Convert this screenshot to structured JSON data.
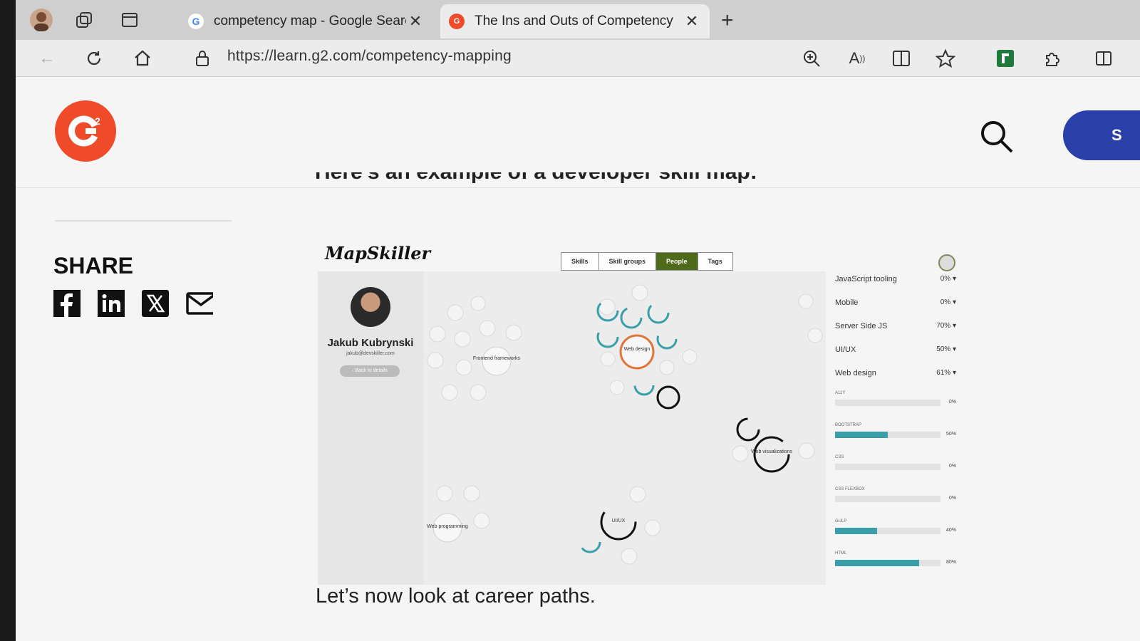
{
  "browser": {
    "tabs": [
      {
        "title": "competency map - Google Searc",
        "favicon": "G",
        "active": false
      },
      {
        "title": "The Ins and Outs of Competency",
        "favicon": "G2",
        "active": true
      }
    ],
    "url": "https://learn.g2.com/competency-mapping"
  },
  "site": {
    "logo_text": "G",
    "signup_label": "S"
  },
  "article": {
    "heading_partial": "Here's an example of a developer skill map:",
    "share_title": "SHARE",
    "share_icons": [
      "facebook-icon",
      "linkedin-icon",
      "x-icon",
      "email-icon"
    ],
    "caption": "Let’s now look at career paths."
  },
  "mapskiller": {
    "logo": "MapSkiller",
    "tabs": [
      "Skills",
      "Skill groups",
      "People",
      "Tags"
    ],
    "active_tab": "People",
    "profile": {
      "name": "Jakub Kubrynski",
      "email": "jakub@devskiller.com",
      "back_label": "‹ Back to details"
    },
    "skill_rows": [
      {
        "label": "JavaScript tooling",
        "pct": "0% ▾"
      },
      {
        "label": "Mobile",
        "pct": "0% ▾"
      },
      {
        "label": "Server Side JS",
        "pct": "70% ▾"
      },
      {
        "label": "UI/UX",
        "pct": "50% ▾"
      },
      {
        "label": "Web design",
        "pct": "61% ▾"
      }
    ],
    "bars": [
      {
        "label": "A11Y",
        "value": 0,
        "pct": "0%"
      },
      {
        "label": "BOOTSTRAP",
        "value": 50,
        "pct": "50%"
      },
      {
        "label": "CSS",
        "value": 0,
        "pct": "0%"
      },
      {
        "label": "CSS FLEXBOX",
        "value": 0,
        "pct": "0%"
      },
      {
        "label": "GULP",
        "value": 40,
        "pct": "40%"
      },
      {
        "label": "HTML",
        "value": 80,
        "pct": "80%"
      }
    ],
    "bubbles": [
      {
        "label": "Frontend frameworks"
      },
      {
        "label": "Web design"
      },
      {
        "label": "Web visualizations"
      },
      {
        "label": "UI/UX"
      },
      {
        "label": "Web programming"
      }
    ],
    "colors": {
      "accent": "#4f6a1a",
      "teal": "#3a9fa8",
      "orange": "#e0763a"
    }
  }
}
